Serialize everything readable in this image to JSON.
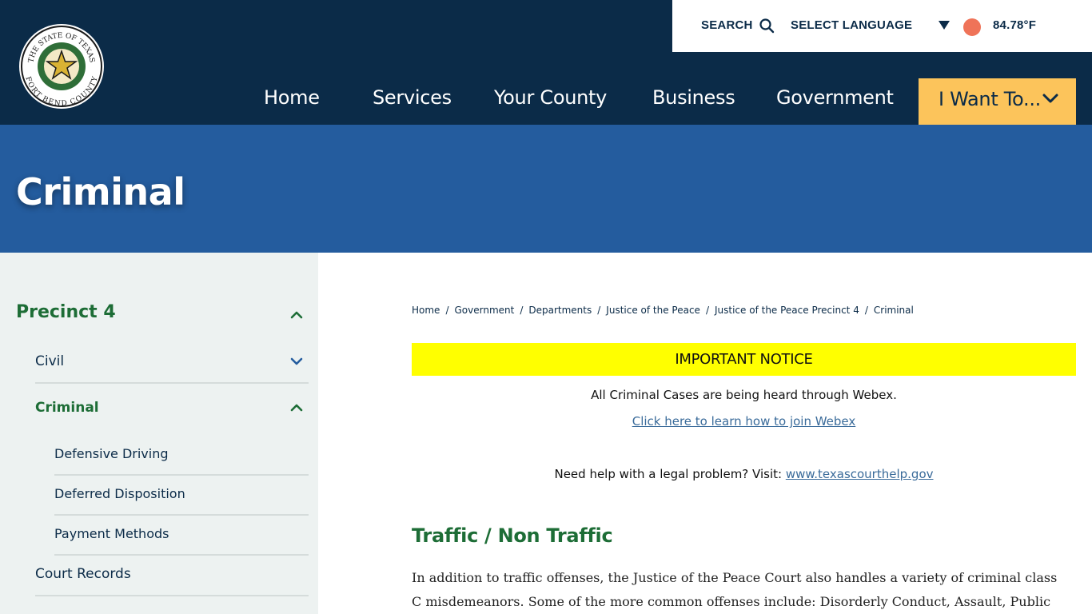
{
  "header": {
    "utility": {
      "search_label": "SEARCH",
      "language_label": "SELECT LANGUAGE",
      "temperature": "84.78°F",
      "weather_dot_color": "#ef7358"
    },
    "nav": [
      {
        "label": "Home"
      },
      {
        "label": "Services"
      },
      {
        "label": "Your County"
      },
      {
        "label": "Business"
      },
      {
        "label": "Government"
      }
    ],
    "i_want_to": "I Want To...",
    "logo": {
      "top_text": "THE STATE OF TEXAS",
      "bottom_text": "FORT BEND COUNTY"
    }
  },
  "banner": {
    "title": "Criminal"
  },
  "sidebar": {
    "heading": "Precinct 4",
    "items": [
      {
        "label": "Civil"
      },
      {
        "label": "Criminal"
      },
      {
        "label": "Court Records"
      }
    ],
    "subitems": [
      {
        "label": "Defensive Driving"
      },
      {
        "label": "Deferred Disposition"
      },
      {
        "label": "Payment Methods"
      }
    ]
  },
  "breadcrumb": [
    "Home",
    "Government",
    "Departments",
    "Justice of the Peace",
    "Justice of the Peace Precinct 4",
    "Criminal"
  ],
  "main": {
    "notice_label": "IMPORTANT NOTICE",
    "notice_text": "All Criminal Cases are being heard through Webex.",
    "notice_link": "Click here to learn how to join Webex",
    "help_text": "Need help with a legal problem? Visit: ",
    "help_link": "www.texascourthelp.gov",
    "section_heading": "Traffic / Non Traffic",
    "paragraph": "In addition to traffic offenses, the Justice of the Peace Court also handles a variety of criminal class C misdemeanors. Some of the more common offenses include: Disorderly Conduct, Assault, Public"
  },
  "colors": {
    "header_bg": "#0b2b48",
    "banner_bg": "#245c9e",
    "accent_yellow": "#fcc45b",
    "notice_yellow": "#ffff00",
    "green": "#1d6d36",
    "sidebar_bg": "#edf2f1"
  },
  "icons": [
    "search-icon",
    "caret-down-icon",
    "weather-icon",
    "chevron-down-icon",
    "chevron-up-icon",
    "county-seal-logo"
  ]
}
